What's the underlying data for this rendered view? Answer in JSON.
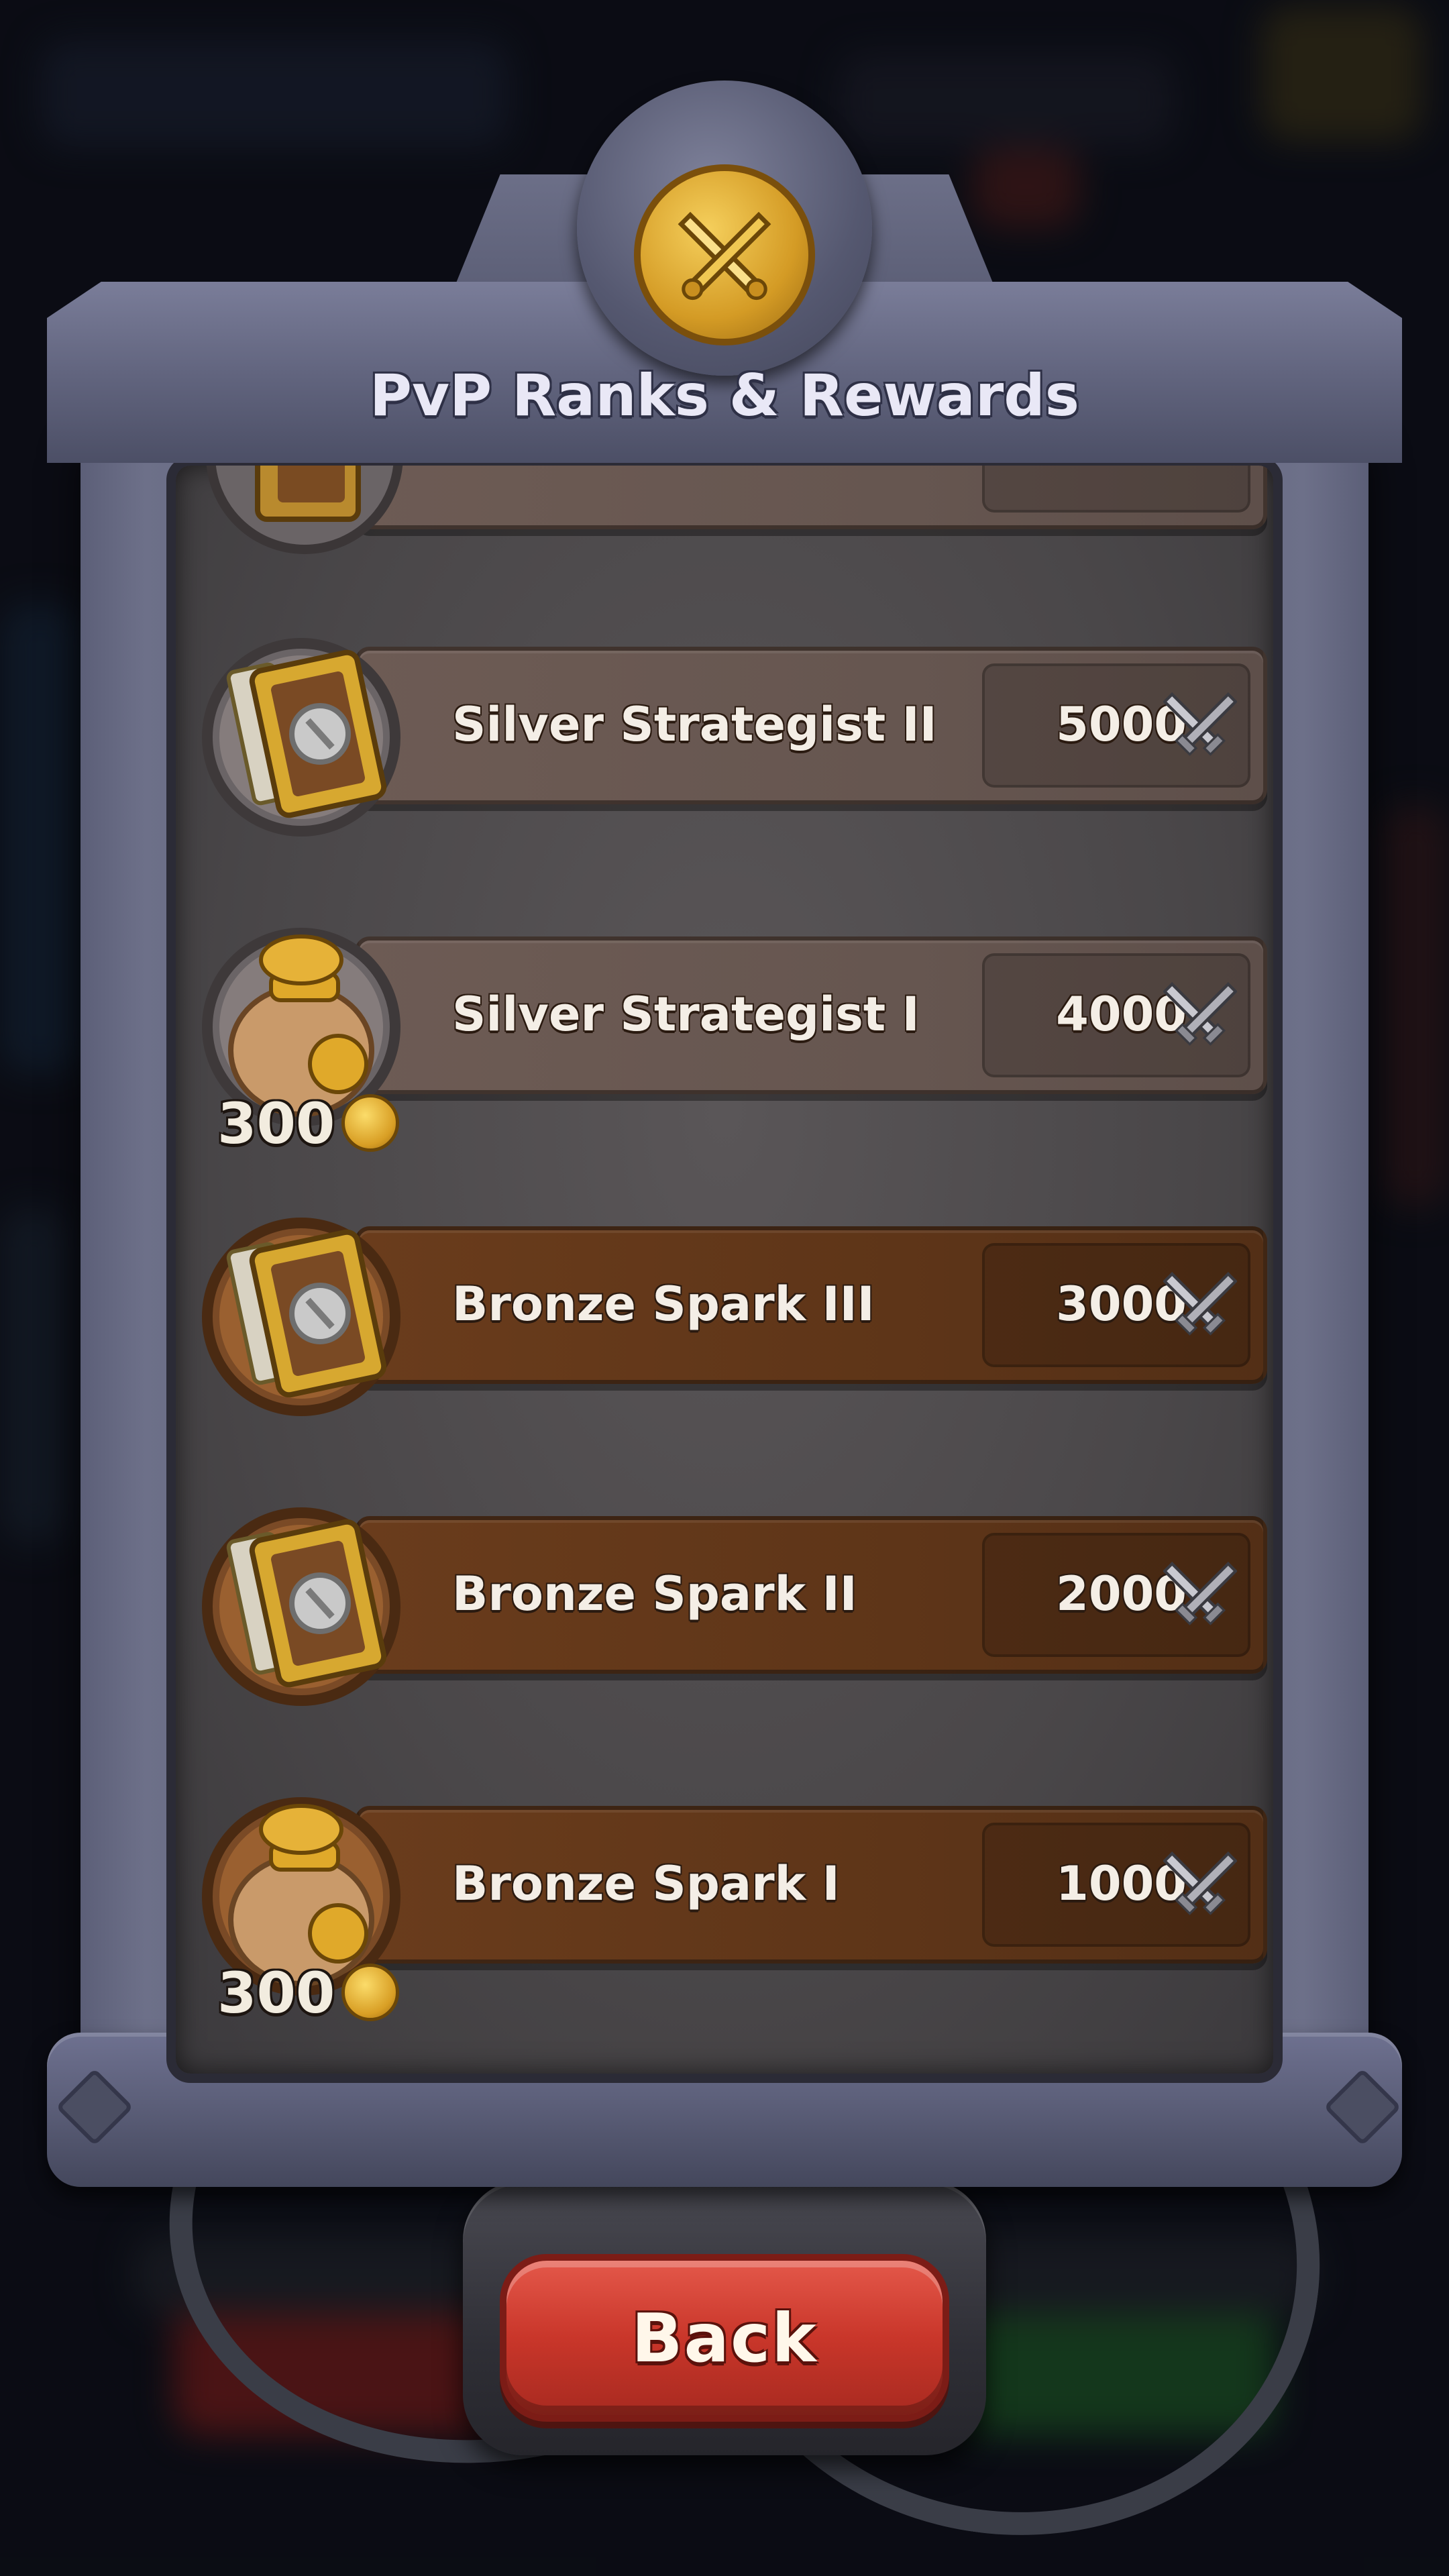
{
  "colors": {
    "panel": "#5c5f78",
    "silver_bar": "#665650",
    "bronze_bar": "#5e3518",
    "back_button": "#c9362a",
    "gold": "#d49b25"
  },
  "header": {
    "title": "PvP Ranks & Rewards",
    "icon": "crossed-swords-medallion-icon"
  },
  "ranks": [
    {
      "name": "Silver Strategist II",
      "points": "5000",
      "tier": "silver",
      "reward": "book-icon",
      "reward_amount": ""
    },
    {
      "name": "Silver Strategist I",
      "points": "4000",
      "tier": "silver",
      "reward": "coin-bag-icon",
      "reward_amount": "300"
    },
    {
      "name": "Bronze Spark III",
      "points": "3000",
      "tier": "bronze",
      "reward": "book-icon",
      "reward_amount": ""
    },
    {
      "name": "Bronze Spark II",
      "points": "2000",
      "tier": "bronze",
      "reward": "book-icon",
      "reward_amount": ""
    },
    {
      "name": "Bronze Spark I",
      "points": "1000",
      "tier": "bronze",
      "reward": "coin-bag-icon",
      "reward_amount": "300"
    }
  ],
  "footer": {
    "back_label": "Back"
  }
}
